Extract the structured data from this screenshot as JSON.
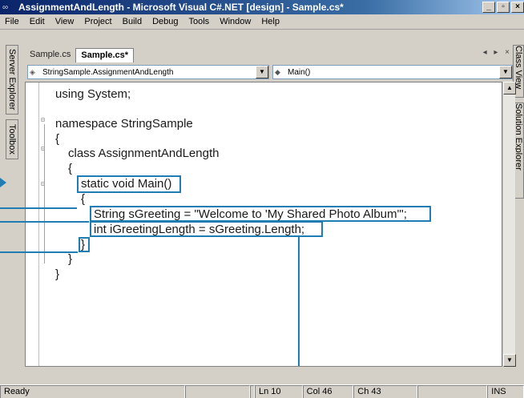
{
  "window": {
    "title": "AssignmentAndLength - Microsoft Visual C#.NET [design] - Sample.cs*",
    "app_icon": "∞",
    "buttons": [
      "_",
      "▫",
      "×"
    ]
  },
  "menu": [
    "File",
    "Edit",
    "View",
    "Project",
    "Build",
    "Debug",
    "Tools",
    "Window",
    "Help"
  ],
  "left_tabs": {
    "server_explorer": "Server Explorer",
    "toolbox": "Toolbox"
  },
  "right_tabs": {
    "class_view": "Class View",
    "solution_explorer": "Solution Explorer"
  },
  "doc_tabs": [
    {
      "label": "Sample.cs",
      "active": false
    },
    {
      "label": "Sample.cs*",
      "active": true
    }
  ],
  "tab_nav": "◂ ▸ ×",
  "navigation": {
    "types_combo": "StringSample.AssignmentAndLength",
    "members_combo": "Main()"
  },
  "code": {
    "lines": [
      "using System;",
      "namespace StringSample",
      "{",
      "class AssignmentAndLength",
      "{",
      "static void Main()",
      "{",
      "String sGreeting = \"Welcome to 'My Shared Photo Album'\";",
      "int iGreetingLength = sGreeting.Length;",
      "}",
      "}",
      "}"
    ]
  },
  "status": {
    "ready": "Ready",
    "ln": "Ln 10",
    "col": "Col 46",
    "ch": "Ch 43",
    "ins": "INS"
  },
  "colors": {
    "callout": "#1f7db3",
    "title_bar": "#0a246a"
  }
}
